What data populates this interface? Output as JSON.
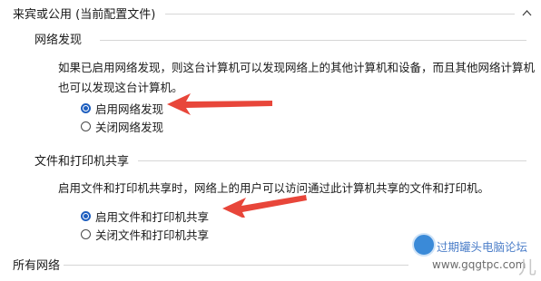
{
  "section": {
    "title": "来宾或公用 (当前配置文件)"
  },
  "network_discovery": {
    "title": "网络发现",
    "description": "如果已启用网络发现，则这台计算机可以发现网络上的其他计算机和设备，而且其他网络计算机也可以发现这台计算机。",
    "options": [
      {
        "label": "启用网络发现",
        "selected": true
      },
      {
        "label": "关闭网络发现",
        "selected": false
      }
    ]
  },
  "file_printer_sharing": {
    "title": "文件和打印机共享",
    "description": "启用文件和打印机共享时，网络上的用户可以访问通过此计算机共享的文件和打印机。",
    "options": [
      {
        "label": "启用文件和打印机共享",
        "selected": true
      },
      {
        "label": "关闭文件和打印机共享",
        "selected": false
      }
    ]
  },
  "all_networks": {
    "title": "所有网络"
  },
  "watermark": {
    "site_name": "过期罐头电脑论坛",
    "url": "www.gqgtpc.com",
    "trailing_char": "儿"
  },
  "colors": {
    "radio_selected": "#1f5fbf",
    "arrow": "#e8463a"
  }
}
